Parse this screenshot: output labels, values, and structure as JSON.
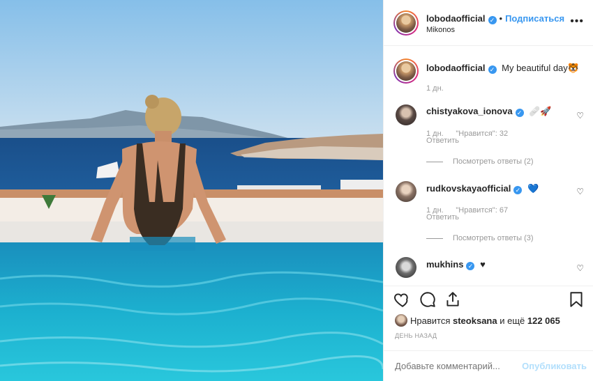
{
  "post": {
    "username": "lobodaofficial",
    "follow_label": "Подписаться",
    "location": "Mikonos",
    "more_label": "•••",
    "caption_text": "My beautiful day",
    "caption_emoji": "🐯",
    "caption_time": "1 дн."
  },
  "comments": [
    {
      "username": "chistyakova_ionova",
      "text": "🩹🚀",
      "time": "1 дн.",
      "likes": "\"Нравится\": 32",
      "reply_label": "Ответить",
      "view_replies": "Посмотреть ответы (2)"
    },
    {
      "username": "rudkovskayaofficial",
      "text": "💙",
      "time": "1 дн.",
      "likes": "\"Нравится\": 67",
      "reply_label": "Ответить",
      "view_replies": "Посмотреть ответы (3)"
    },
    {
      "username": "mukhins",
      "text": "♥"
    }
  ],
  "likes_line": {
    "prefix": "Нравится",
    "user": "steoksana",
    "middle": "и ещё",
    "count": "122 065"
  },
  "posted_time": "ДЕНЬ НАЗАД",
  "comment_box": {
    "placeholder": "Добавьте комментарий...",
    "post_label": "Опубликовать"
  },
  "icons": [
    "heart-icon",
    "comment-icon",
    "share-icon",
    "bookmark-icon",
    "verified-badge-icon",
    "more-options-icon"
  ],
  "colors": {
    "accent": "#3897f0",
    "muted": "#999999",
    "border": "#efefef",
    "post_disabled": "#b2dffc"
  }
}
